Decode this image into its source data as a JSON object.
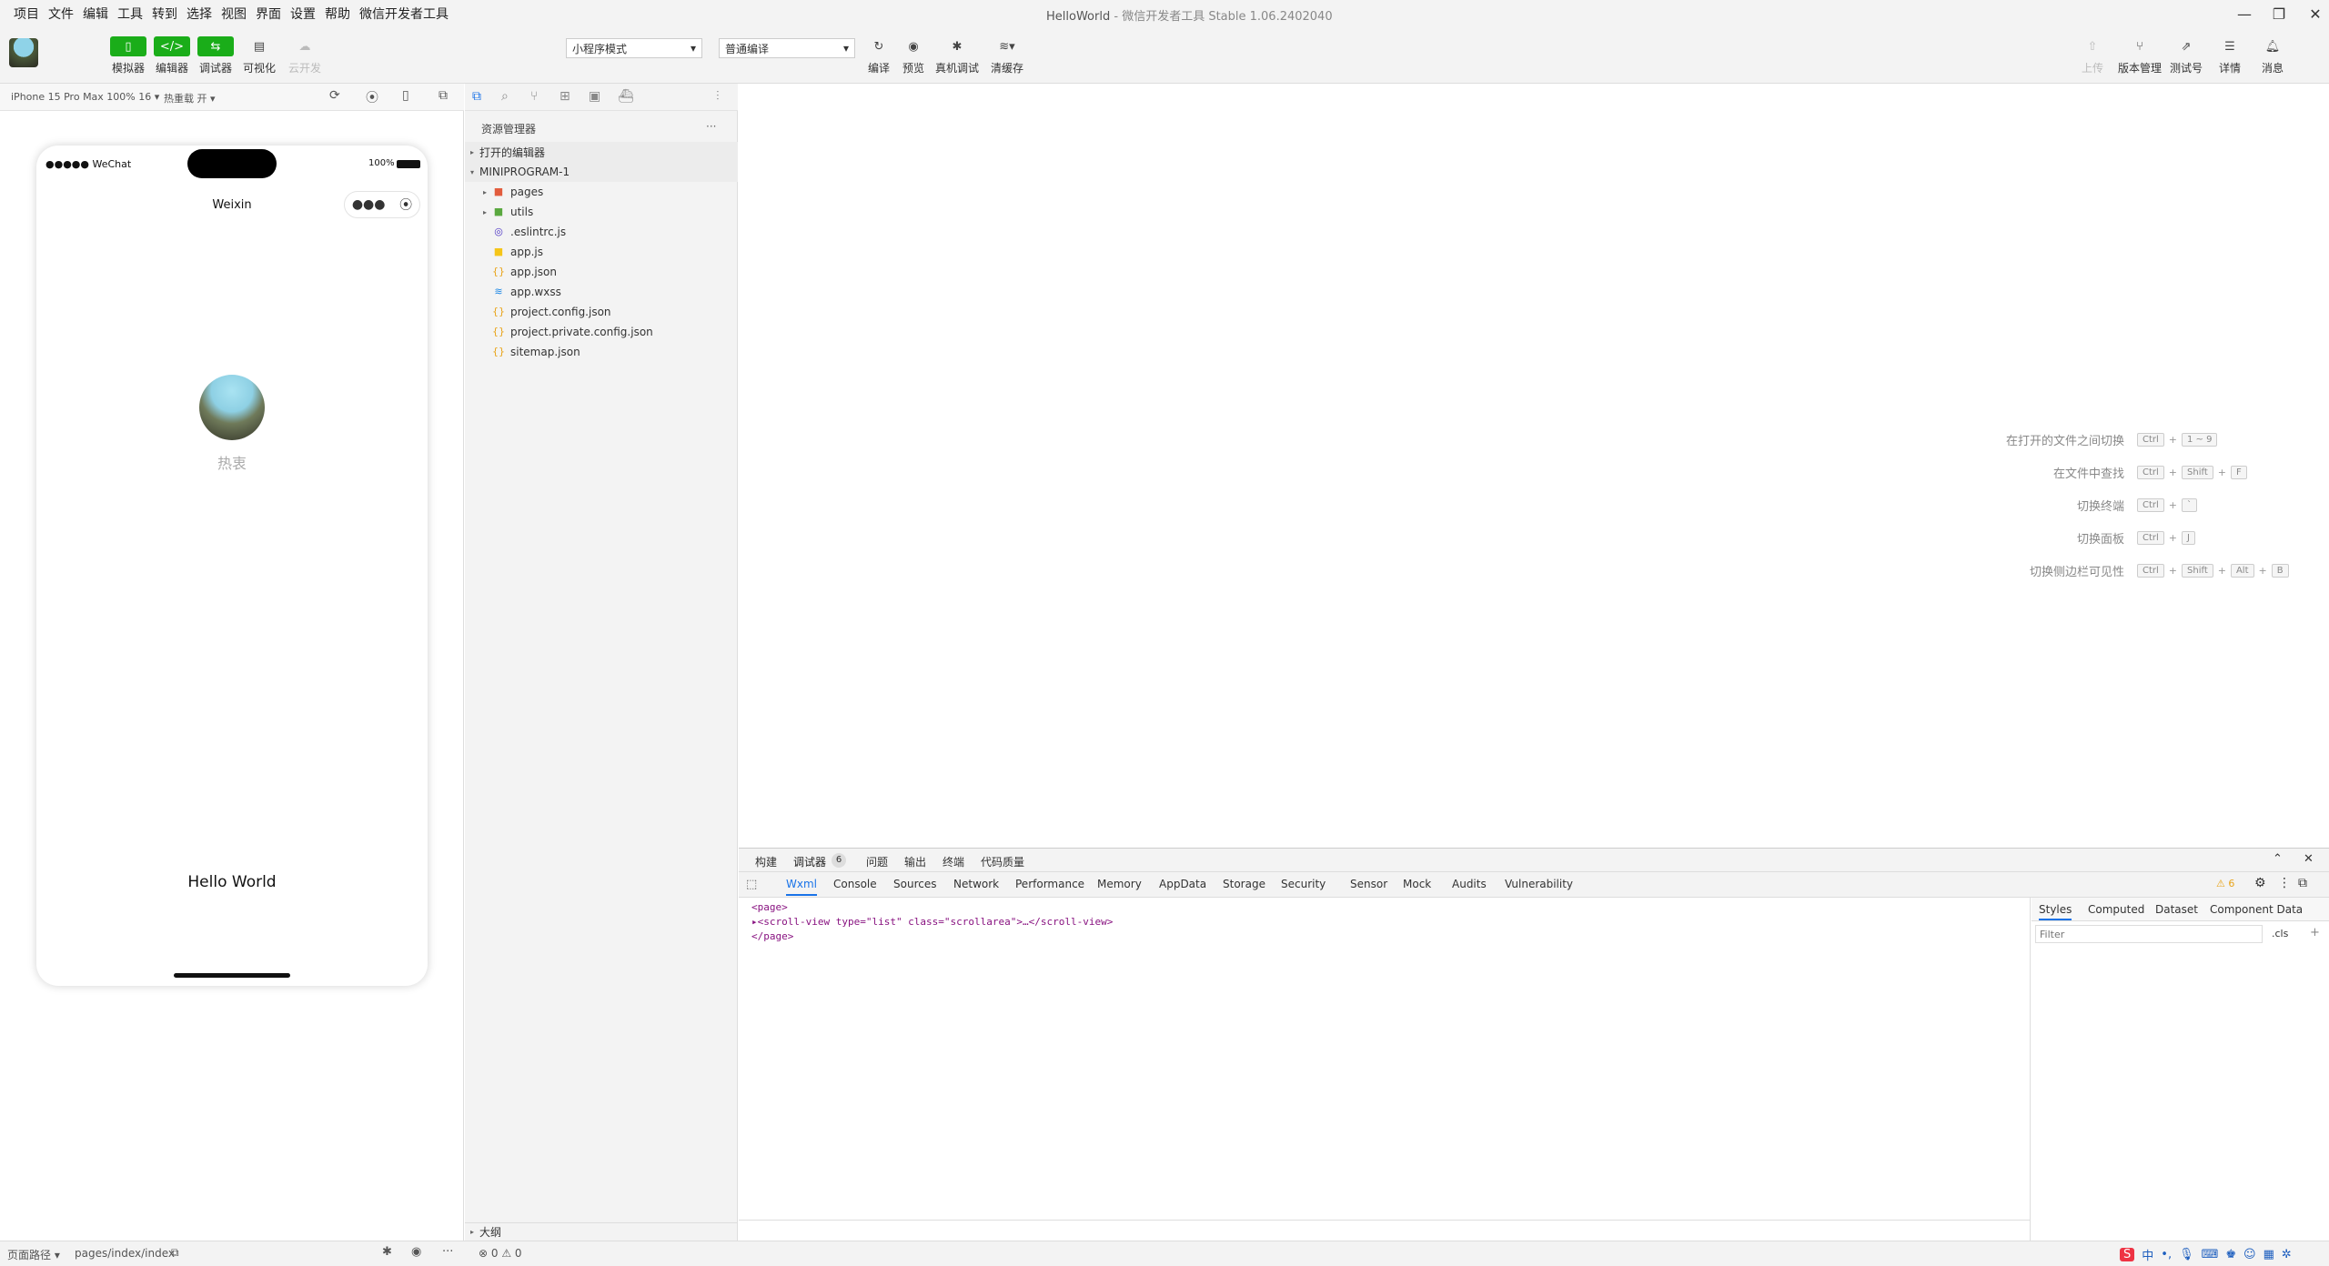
{
  "menubar": {
    "items": [
      "项目",
      "文件",
      "编辑",
      "工具",
      "转到",
      "选择",
      "视图",
      "界面",
      "设置",
      "帮助",
      "微信开发者工具"
    ],
    "title": "HelloWorld",
    "subtitle": "微信开发者工具 Stable 1.06.2402040"
  },
  "toolbar": {
    "simulator": "模拟器",
    "editor": "编辑器",
    "debugger": "调试器",
    "visual": "可视化",
    "cloud": "云开发",
    "mode_select": "小程序模式",
    "compile_select": "普通编译",
    "compile": "编译",
    "preview": "预览",
    "real_debug": "真机调试",
    "clear_cache": "清缓存",
    "upload": "上传",
    "version": "版本管理",
    "test": "测试号",
    "details": "详情",
    "messages": "消息"
  },
  "simulator": {
    "device": "iPhone 15 Pro Max 100% 16 ▾",
    "hotreload": "热重载 开 ▾",
    "status_signal": "●●●●● WeChat",
    "battery": "100%",
    "nav_title": "Weixin",
    "nickname": "热衷",
    "hello": "Hello World"
  },
  "explorer": {
    "title": "资源管理器",
    "more": "···",
    "open_editors": "打开的编辑器",
    "project": "MINIPROGRAM-1",
    "files": [
      {
        "name": "pages",
        "type": "folder-red"
      },
      {
        "name": "utils",
        "type": "folder-green"
      },
      {
        "name": ".eslintrc.js",
        "type": "eslint"
      },
      {
        "name": "app.js",
        "type": "js"
      },
      {
        "name": "app.json",
        "type": "json"
      },
      {
        "name": "app.wxss",
        "type": "wxss"
      },
      {
        "name": "project.config.json",
        "type": "json"
      },
      {
        "name": "project.private.config.json",
        "type": "json"
      },
      {
        "name": "sitemap.json",
        "type": "json"
      }
    ],
    "outline": "大纲",
    "status": "⊗ 0 ⚠ 0"
  },
  "editor": {
    "hints": [
      {
        "label": "在打开的文件之间切换",
        "keys": [
          "Ctrl",
          "1 ~ 9"
        ]
      },
      {
        "label": "在文件中查找",
        "keys": [
          "Ctrl",
          "Shift",
          "F"
        ]
      },
      {
        "label": "切换终端",
        "keys": [
          "Ctrl",
          "`"
        ]
      },
      {
        "label": "切换面板",
        "keys": [
          "Ctrl",
          "J"
        ]
      },
      {
        "label": "切换侧边栏可见性",
        "keys": [
          "Ctrl",
          "Shift",
          "Alt",
          "B"
        ]
      }
    ]
  },
  "devtools": {
    "top_tabs": [
      "构建",
      "调试器",
      "问题",
      "输出",
      "终端",
      "代码质量"
    ],
    "debugger_badge": "6",
    "tabs": [
      "Wxml",
      "Console",
      "Sources",
      "Network",
      "Performance",
      "Memory",
      "AppData",
      "Storage",
      "Security",
      "Sensor",
      "Mock",
      "Audits",
      "Vulnerability"
    ],
    "warn_count": "6",
    "wxml_lines": [
      "<page>",
      "▸<scroll-view type=\"list\" class=\"scrollarea\">…</scroll-view>",
      "</page>"
    ],
    "style_tabs": [
      "Styles",
      "Computed",
      "Dataset",
      "Component Data"
    ],
    "filter_placeholder": "Filter",
    "cls": ".cls",
    "add": "+"
  },
  "bottom": {
    "page_path_label": "页面路径 ▾",
    "page_path": "pages/index/index"
  },
  "colors": {
    "accent": "#1aad19",
    "link": "#1a73e8"
  }
}
